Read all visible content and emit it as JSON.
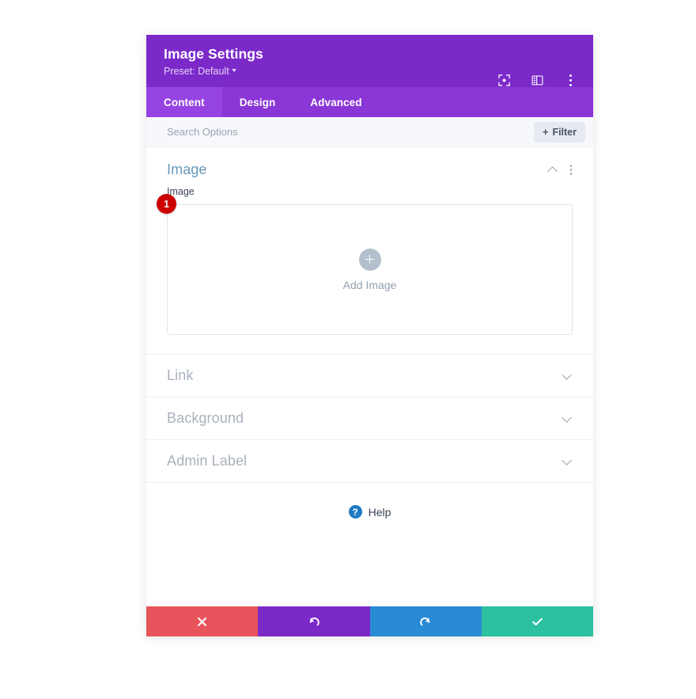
{
  "header": {
    "title": "Image Settings",
    "preset_label": "Preset: Default",
    "icons": {
      "focus": "focus-target-icon",
      "layout": "panel-layout-icon",
      "more": "kebab-menu-icon"
    }
  },
  "tabs": [
    {
      "label": "Content",
      "active": true
    },
    {
      "label": "Design",
      "active": false
    },
    {
      "label": "Advanced",
      "active": false
    }
  ],
  "search": {
    "placeholder": "Search Options",
    "value": "",
    "filter_label": "Filter",
    "filter_plus": "+"
  },
  "sections": {
    "image": {
      "title": "Image",
      "expanded": true,
      "field_label": "Image",
      "upload": {
        "add_label": "Add Image",
        "plus_icon": "plus-circle-icon"
      },
      "badge": "1"
    },
    "collapsed": [
      {
        "title": "Link"
      },
      {
        "title": "Background"
      },
      {
        "title": "Admin Label"
      }
    ]
  },
  "help": {
    "label": "Help",
    "marker": "?"
  },
  "footer": {
    "buttons": [
      {
        "name": "cancel",
        "icon": "close-x-icon",
        "color": "#e8545b"
      },
      {
        "name": "undo",
        "icon": "undo-arrow-icon",
        "color": "#7b29c9"
      },
      {
        "name": "redo",
        "icon": "redo-arrow-icon",
        "color": "#2a8bd5"
      },
      {
        "name": "save",
        "icon": "check-icon",
        "color": "#2cc1a0"
      }
    ]
  },
  "colors": {
    "header_purple": "#7b29c9",
    "tabbar_purple": "#8b36d6",
    "active_tab_purple": "#9543e2",
    "section_title_blue": "#6699bb",
    "badge_red": "#cc0000",
    "help_blue": "#1f7ac4"
  }
}
